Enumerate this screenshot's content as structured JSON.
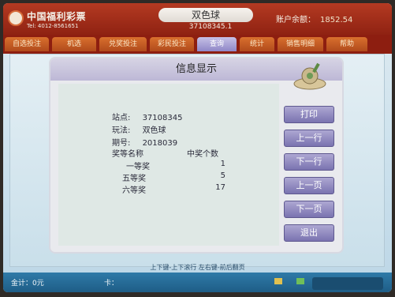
{
  "header": {
    "brand_name": "中国福利彩票",
    "brand_sub": "Tel: 4012-8561651",
    "game_name": "双色球",
    "station_id": "37108345.1",
    "balance_label": "账户余额：",
    "balance_value": "1852.54"
  },
  "tabs": [
    {
      "label": "自选投注"
    },
    {
      "label": "机选"
    },
    {
      "label": "兑奖投注"
    },
    {
      "label": "彩民投注"
    },
    {
      "label": "查询"
    },
    {
      "label": "统计"
    },
    {
      "label": "销售明细"
    },
    {
      "label": "帮助"
    }
  ],
  "dialog": {
    "title": "信息显示",
    "station_label": "站点:",
    "station_value": "37108345",
    "play_label": "玩法:",
    "play_value": "双色球",
    "period_label": "期号:",
    "period_value": "2018039",
    "prize_header_name": "奖等名称",
    "prize_header_count": "中奖个数",
    "prizes": [
      {
        "name": "一等奖",
        "count": "1"
      },
      {
        "name": "五等奖",
        "count": "5"
      },
      {
        "name": "六等奖",
        "count": "17"
      }
    ]
  },
  "buttons": {
    "print": "打印",
    "prev_line": "上一行",
    "next_line": "下一行",
    "prev_page": "上一页",
    "next_page": "下一页",
    "exit": "退出"
  },
  "hint": "上下键-上下滚行  左右键-前后翻页",
  "status": {
    "amount_label": "金计：",
    "amount_value": "0元",
    "card_label": "卡："
  },
  "colors": {
    "header_red": "#b43a22",
    "button_purple": "#8f87c7",
    "status_blue": "#2f7aa8"
  }
}
